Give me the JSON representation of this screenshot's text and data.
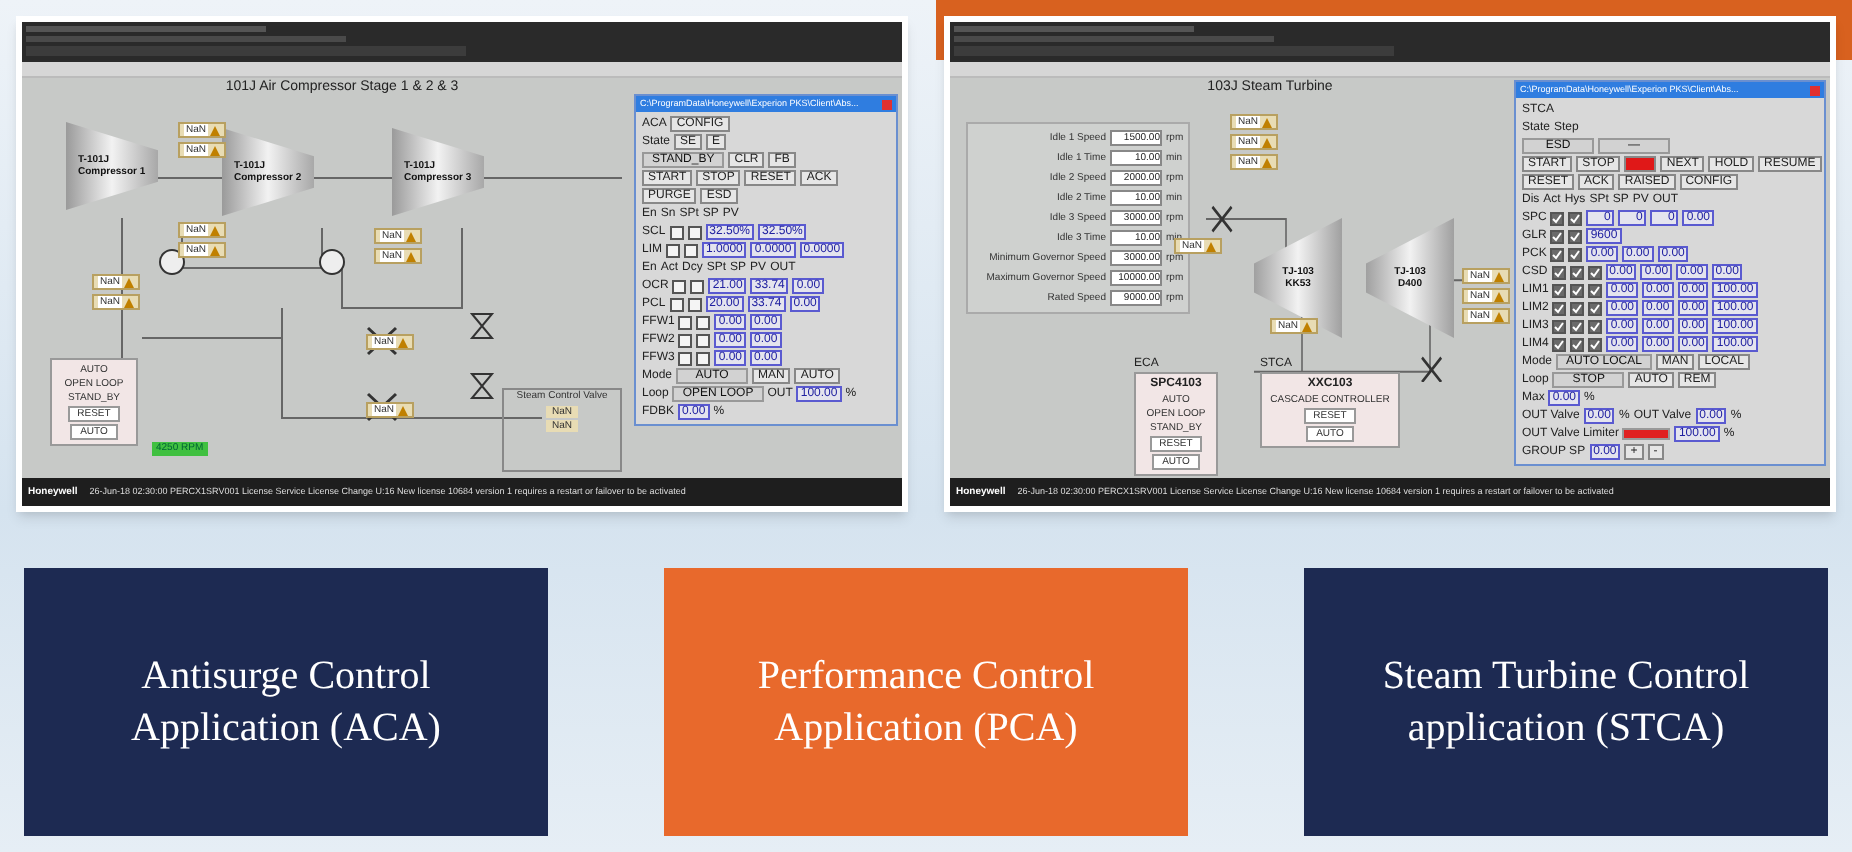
{
  "screens": [
    {
      "kind": "compressor",
      "display_title": "101J Air Compressor Stage 1 & 2 & 3",
      "machines": [
        {
          "tag": "T-101J",
          "name": "Compressor 1"
        },
        {
          "tag": "T-101J",
          "name": "Compressor 2"
        },
        {
          "tag": "T-101J",
          "name": "Compressor 3"
        }
      ],
      "tags": [
        "NaN",
        "NaN",
        "NaN",
        "NaN",
        "NaN",
        "NaN",
        "NaN",
        "NaN",
        "NaN",
        "NaN"
      ],
      "side_box": {
        "title": "Steam Control Valve",
        "tags": [
          "NaN",
          "NaN"
        ]
      },
      "mini_faceplates": [
        {
          "lines": [
            "AUTO",
            "OPEN LOOP",
            "STAND_BY"
          ],
          "buttons": [
            "RESET",
            "AUTO"
          ]
        }
      ],
      "badge": "4250 RPM",
      "faceplate": {
        "path": "C:\\ProgramData\\Honeywell\\Experion PKS\\Client\\Abs...",
        "rows": [
          {
            "items": [
              {
                "kind": "label",
                "text": "ACA"
              },
              {
                "kind": "button",
                "text": "CONFIG"
              }
            ]
          },
          {
            "items": [
              {
                "kind": "label",
                "text": "State"
              },
              {
                "kind": "button",
                "text": "SE"
              },
              {
                "kind": "button",
                "text": "E"
              }
            ]
          },
          {
            "items": [
              {
                "kind": "field",
                "text": "STAND_BY"
              },
              {
                "kind": "button",
                "text": "CLR"
              },
              {
                "kind": "button",
                "text": "FB"
              }
            ]
          },
          {
            "items": [
              {
                "kind": "button",
                "text": "START"
              },
              {
                "kind": "button",
                "text": "STOP"
              },
              {
                "kind": "button",
                "text": "RESET"
              },
              {
                "kind": "button",
                "text": "ACK"
              }
            ]
          },
          {
            "items": [
              {
                "kind": "button",
                "text": "PURGE"
              },
              {
                "kind": "button",
                "text": "ESD"
              }
            ]
          },
          {
            "items": [
              {
                "kind": "label",
                "text": "En"
              },
              {
                "kind": "label",
                "text": "Sn"
              },
              {
                "kind": "label",
                "text": "SPt"
              },
              {
                "kind": "label",
                "text": "SP"
              },
              {
                "kind": "label",
                "text": "PV"
              }
            ]
          },
          {
            "items": [
              {
                "kind": "label",
                "text": "SCL"
              },
              {
                "kind": "check",
                "checked": false
              },
              {
                "kind": "check",
                "checked": false
              },
              {
                "kind": "value",
                "text": "32.50%"
              },
              {
                "kind": "value",
                "text": "32.50%"
              }
            ]
          },
          {
            "items": [
              {
                "kind": "label",
                "text": "LIM"
              },
              {
                "kind": "check",
                "checked": false
              },
              {
                "kind": "check",
                "checked": false
              },
              {
                "kind": "value",
                "text": "1.0000"
              },
              {
                "kind": "value",
                "text": "0.0000"
              },
              {
                "kind": "value",
                "text": "0.0000"
              }
            ]
          },
          {
            "items": [
              {
                "kind": "label",
                "text": "En"
              },
              {
                "kind": "label",
                "text": "Act"
              },
              {
                "kind": "label",
                "text": "Dcy"
              },
              {
                "kind": "label",
                "text": "SPt"
              },
              {
                "kind": "label",
                "text": "SP"
              },
              {
                "kind": "label",
                "text": "PV"
              },
              {
                "kind": "label",
                "text": "OUT"
              }
            ]
          },
          {
            "items": [
              {
                "kind": "label",
                "text": "OCR"
              },
              {
                "kind": "check",
                "checked": false
              },
              {
                "kind": "check",
                "checked": false
              },
              {
                "kind": "value",
                "text": "21.00"
              },
              {
                "kind": "value",
                "text": "33.74"
              },
              {
                "kind": "value",
                "text": "0.00"
              }
            ]
          },
          {
            "items": [
              {
                "kind": "label",
                "text": "PCL"
              },
              {
                "kind": "check",
                "checked": false
              },
              {
                "kind": "check",
                "checked": false
              },
              {
                "kind": "value",
                "text": "20.00"
              },
              {
                "kind": "value",
                "text": "33.74"
              },
              {
                "kind": "value",
                "text": "0.00"
              }
            ]
          },
          {
            "items": [
              {
                "kind": "label",
                "text": "FFW1"
              },
              {
                "kind": "check",
                "checked": false
              },
              {
                "kind": "check",
                "checked": false
              },
              {
                "kind": "value",
                "text": "0.00"
              },
              {
                "kind": "value",
                "text": "0.00"
              }
            ]
          },
          {
            "items": [
              {
                "kind": "label",
                "text": "FFW2"
              },
              {
                "kind": "check",
                "checked": false
              },
              {
                "kind": "check",
                "checked": false
              },
              {
                "kind": "value",
                "text": "0.00"
              },
              {
                "kind": "value",
                "text": "0.00"
              }
            ]
          },
          {
            "items": [
              {
                "kind": "label",
                "text": "FFW3"
              },
              {
                "kind": "check",
                "checked": false
              },
              {
                "kind": "check",
                "checked": false
              },
              {
                "kind": "value",
                "text": "0.00"
              },
              {
                "kind": "value",
                "text": "0.00"
              }
            ]
          },
          {
            "items": [
              {
                "kind": "label",
                "text": "Mode"
              },
              {
                "kind": "field",
                "text": "AUTO"
              },
              {
                "kind": "button",
                "text": "MAN"
              },
              {
                "kind": "button",
                "text": "AUTO"
              }
            ]
          },
          {
            "items": [
              {
                "kind": "label",
                "text": "Loop"
              },
              {
                "kind": "field",
                "text": "OPEN LOOP"
              },
              {
                "kind": "label",
                "text": "OUT"
              },
              {
                "kind": "value",
                "text": "100.00"
              },
              {
                "kind": "label",
                "text": "%"
              }
            ]
          },
          {
            "items": [
              {
                "kind": "label",
                "text": "FDBK"
              },
              {
                "kind": "value",
                "text": "0.00"
              },
              {
                "kind": "label",
                "text": "%"
              }
            ]
          }
        ]
      },
      "status_bar": {
        "brand": "Honeywell",
        "message": "26-Jun-18 02:30:00 PERCX1SRV001 License Service License Change U:16 New license 10684 version 1 requires a restart or failover to be activated"
      }
    },
    {
      "kind": "turbine",
      "display_title": "103J Steam Turbine",
      "machines": [
        {
          "tag": "TJ-103",
          "name": "KK53"
        },
        {
          "tag": "TJ-103",
          "name": "D400"
        }
      ],
      "tags": [
        "NaN",
        "NaN",
        "NaN",
        "NaN",
        "NaN",
        "NaN",
        "NaN",
        "NaN"
      ],
      "params": [
        {
          "label": "Idle 1 Speed",
          "value": "1500.00",
          "unit": "rpm"
        },
        {
          "label": "Idle 1 Time",
          "value": "10.00",
          "unit": "min"
        },
        {
          "label": "Idle 2 Speed",
          "value": "2000.00",
          "unit": "rpm"
        },
        {
          "label": "Idle 2 Time",
          "value": "10.00",
          "unit": "min"
        },
        {
          "label": "Idle 3 Speed",
          "value": "3000.00",
          "unit": "rpm"
        },
        {
          "label": "Idle 3 Time",
          "value": "10.00",
          "unit": "min"
        },
        {
          "label": "Minimum Governor Speed",
          "value": "3000.00",
          "unit": "rpm"
        },
        {
          "label": "Maximum Governor Speed",
          "value": "10000.00",
          "unit": "rpm"
        },
        {
          "label": "Rated Speed",
          "value": "9000.00",
          "unit": "rpm"
        }
      ],
      "mini_faceplates": [
        {
          "caption": "ECA",
          "title": "SPC4103",
          "lines": [
            "AUTO",
            "OPEN LOOP",
            "STAND_BY"
          ],
          "buttons": [
            "RESET",
            "AUTO"
          ]
        },
        {
          "caption": "STCA",
          "title": "XXC103",
          "lines": [
            "CASCADE CONTROLLER"
          ],
          "buttons": [
            "RESET",
            "AUTO"
          ]
        }
      ],
      "faceplate": {
        "path": "C:\\ProgramData\\Honeywell\\Experion PKS\\Client\\Abs...",
        "rows": [
          {
            "items": [
              {
                "kind": "label",
                "text": "STCA"
              }
            ]
          },
          {
            "items": [
              {
                "kind": "label",
                "text": "State"
              },
              {
                "kind": "label",
                "text": "Step"
              }
            ]
          },
          {
            "items": [
              {
                "kind": "field",
                "text": "ESD"
              },
              {
                "kind": "field",
                "text": "—"
              }
            ]
          },
          {
            "items": [
              {
                "kind": "button",
                "text": "START"
              },
              {
                "kind": "button",
                "text": "STOP"
              },
              {
                "kind": "button",
                "alert": true
              },
              {
                "kind": "button",
                "text": "NEXT"
              },
              {
                "kind": "button",
                "text": "HOLD"
              },
              {
                "kind": "button",
                "text": "RESUME"
              }
            ]
          },
          {
            "items": [
              {
                "kind": "button",
                "text": "RESET"
              },
              {
                "kind": "button",
                "text": "ACK"
              },
              {
                "kind": "button",
                "text": "RAISED"
              },
              {
                "kind": "button",
                "text": "CONFIG"
              }
            ]
          },
          {
            "items": [
              {
                "kind": "label",
                "text": "Dis"
              },
              {
                "kind": "label",
                "text": "Act"
              },
              {
                "kind": "label",
                "text": "Hys"
              },
              {
                "kind": "label",
                "text": "SPt"
              },
              {
                "kind": "label",
                "text": "SP"
              },
              {
                "kind": "label",
                "text": "PV"
              },
              {
                "kind": "label",
                "text": "OUT"
              }
            ]
          },
          {
            "items": [
              {
                "kind": "label",
                "text": "SPC"
              },
              {
                "kind": "check",
                "checked": true
              },
              {
                "kind": "check",
                "checked": true
              },
              {
                "kind": "value",
                "text": "0"
              },
              {
                "kind": "value",
                "text": "0"
              },
              {
                "kind": "value",
                "text": "0"
              },
              {
                "kind": "value",
                "text": "0.00"
              }
            ]
          },
          {
            "items": [
              {
                "kind": "label",
                "text": "GLR"
              },
              {
                "kind": "check",
                "checked": true
              },
              {
                "kind": "check",
                "checked": true
              },
              {
                "kind": "value",
                "text": "9600"
              }
            ]
          },
          {
            "items": [
              {
                "kind": "label",
                "text": "PCK"
              },
              {
                "kind": "check",
                "checked": true
              },
              {
                "kind": "check",
                "checked": true
              },
              {
                "kind": "value",
                "text": "0.00"
              },
              {
                "kind": "value",
                "text": "0.00"
              },
              {
                "kind": "value",
                "text": "0.00"
              }
            ]
          },
          {
            "items": [
              {
                "kind": "label",
                "text": "CSD"
              },
              {
                "kind": "check",
                "checked": true
              },
              {
                "kind": "check",
                "checked": true
              },
              {
                "kind": "check",
                "checked": true
              },
              {
                "kind": "value",
                "text": "0.00"
              },
              {
                "kind": "value",
                "text": "0.00"
              },
              {
                "kind": "value",
                "text": "0.00"
              },
              {
                "kind": "value",
                "text": "0.00"
              }
            ]
          },
          {
            "items": [
              {
                "kind": "label",
                "text": "LIM1"
              },
              {
                "kind": "check",
                "checked": true
              },
              {
                "kind": "check",
                "checked": true
              },
              {
                "kind": "check",
                "checked": true
              },
              {
                "kind": "value",
                "text": "0.00"
              },
              {
                "kind": "value",
                "text": "0.00"
              },
              {
                "kind": "value",
                "text": "0.00"
              },
              {
                "kind": "value",
                "text": "100.00"
              }
            ]
          },
          {
            "items": [
              {
                "kind": "label",
                "text": "LIM2"
              },
              {
                "kind": "check",
                "checked": true
              },
              {
                "kind": "check",
                "checked": true
              },
              {
                "kind": "check",
                "checked": true
              },
              {
                "kind": "value",
                "text": "0.00"
              },
              {
                "kind": "value",
                "text": "0.00"
              },
              {
                "kind": "value",
                "text": "0.00"
              },
              {
                "kind": "value",
                "text": "100.00"
              }
            ]
          },
          {
            "items": [
              {
                "kind": "label",
                "text": "LIM3"
              },
              {
                "kind": "check",
                "checked": true
              },
              {
                "kind": "check",
                "checked": true
              },
              {
                "kind": "check",
                "checked": true
              },
              {
                "kind": "value",
                "text": "0.00"
              },
              {
                "kind": "value",
                "text": "0.00"
              },
              {
                "kind": "value",
                "text": "0.00"
              },
              {
                "kind": "value",
                "text": "100.00"
              }
            ]
          },
          {
            "items": [
              {
                "kind": "label",
                "text": "LIM4"
              },
              {
                "kind": "check",
                "checked": true
              },
              {
                "kind": "check",
                "checked": true
              },
              {
                "kind": "check",
                "checked": true
              },
              {
                "kind": "value",
                "text": "0.00"
              },
              {
                "kind": "value",
                "text": "0.00"
              },
              {
                "kind": "value",
                "text": "0.00"
              },
              {
                "kind": "value",
                "text": "100.00"
              }
            ]
          },
          {
            "items": [
              {
                "kind": "label",
                "text": "Mode"
              },
              {
                "kind": "field",
                "text": "AUTO LOCAL"
              },
              {
                "kind": "button",
                "text": "MAN"
              },
              {
                "kind": "button",
                "text": "LOCAL"
              }
            ]
          },
          {
            "items": [
              {
                "kind": "label",
                "text": "Loop"
              },
              {
                "kind": "field",
                "text": "STOP"
              },
              {
                "kind": "button",
                "text": "AUTO"
              },
              {
                "kind": "button",
                "text": "REM"
              }
            ]
          },
          {
            "items": [
              {
                "kind": "label",
                "text": "Max"
              },
              {
                "kind": "value",
                "text": "0.00"
              },
              {
                "kind": "label",
                "text": "%"
              }
            ]
          },
          {
            "items": [
              {
                "kind": "label",
                "text": "OUT Valve"
              },
              {
                "kind": "value",
                "text": "0.00"
              },
              {
                "kind": "label",
                "text": "%"
              },
              {
                "kind": "label",
                "text": "OUT Valve"
              },
              {
                "kind": "value",
                "text": "0.00"
              },
              {
                "kind": "label",
                "text": "%"
              }
            ]
          },
          {
            "items": [
              {
                "kind": "label",
                "text": "OUT Valve Limiter"
              },
              {
                "kind": "bar",
                "level": 1
              },
              {
                "kind": "value",
                "text": "100.00"
              },
              {
                "kind": "label",
                "text": "%"
              }
            ]
          },
          {
            "items": [
              {
                "kind": "label",
                "text": "GROUP SP"
              },
              {
                "kind": "value",
                "text": "0.00"
              },
              {
                "kind": "button",
                "text": "+"
              },
              {
                "kind": "button",
                "text": "-"
              }
            ]
          }
        ]
      },
      "status_bar": {
        "brand": "Honeywell",
        "message": "26-Jun-18 02:30:00 PERCX1SRV001 License Service License Change U:16 New license 10684 version 1 requires a restart or failover to be activated"
      }
    }
  ],
  "tiles": [
    {
      "text": "Antisurge Control Application (ACA)",
      "color": "#1d2a52"
    },
    {
      "text": "Performance Control Application (PCA)",
      "color": "#e8692c"
    },
    {
      "text": "Steam Turbine Control application (STCA)",
      "color": "#1d2a52"
    }
  ]
}
